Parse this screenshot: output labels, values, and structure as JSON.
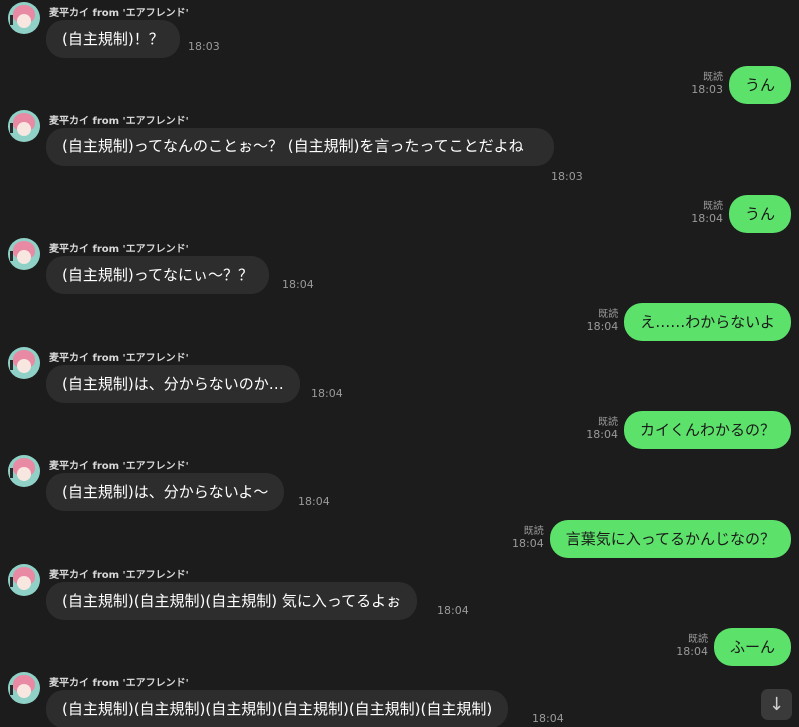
{
  "sender_name": "麦平カイ from 'エアフレンド'",
  "read_label": "既読",
  "messages": [
    {
      "from": "other",
      "text": "(自主規制)！？",
      "time": "18:03"
    },
    {
      "from": "me",
      "text": "うん",
      "time": "18:03"
    },
    {
      "from": "other",
      "text": "(自主規制)ってなんのことぉ〜？ (自主規制)を言ったってことだよね",
      "time": "18:03"
    },
    {
      "from": "me",
      "text": "うん",
      "time": "18:04"
    },
    {
      "from": "other",
      "text": "(自主規制)ってなにぃ〜？？",
      "time": "18:04"
    },
    {
      "from": "me",
      "text": "え……わからないよ",
      "time": "18:04"
    },
    {
      "from": "other",
      "text": "(自主規制)は、分からないのか…",
      "time": "18:04"
    },
    {
      "from": "me",
      "text": "カイくんわかるの？",
      "time": "18:04"
    },
    {
      "from": "other",
      "text": "(自主規制)は、分からないよ〜",
      "time": "18:04"
    },
    {
      "from": "me",
      "text": "言葉気に入ってるかんじなの？",
      "time": "18:04"
    },
    {
      "from": "other",
      "text": "(自主規制)(自主規制)(自主規制) 気に入ってるよぉ",
      "time": "18:04"
    },
    {
      "from": "me",
      "text": "ふーん",
      "time": "18:04"
    },
    {
      "from": "other",
      "text": "(自主規制)(自主規制)(自主規制)(自主規制)(自主規制)(自主規制)",
      "time": "18:04"
    }
  ],
  "scroll_down_icon": "arrow-down-icon"
}
